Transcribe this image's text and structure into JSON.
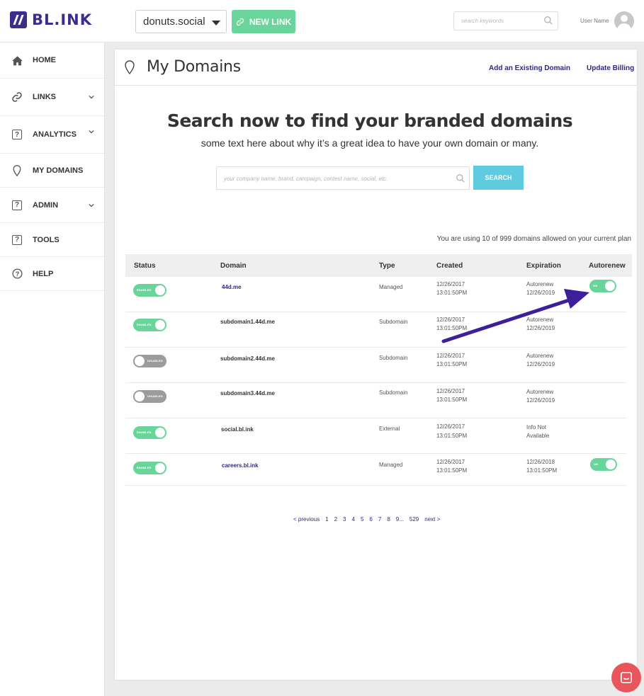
{
  "app": {
    "logo_text": "BL.INK",
    "brand_color": "#3a2d8c",
    "accent_green": "#6ad59a",
    "accent_blue": "#5ecbe0"
  },
  "topbar": {
    "domain_select_value": "donuts.social",
    "new_link_label": "NEW LINK",
    "search_placeholder": "search keywords",
    "user_name": "User Name"
  },
  "sidebar": {
    "items": [
      {
        "label": "HOME",
        "icon": "home-icon"
      },
      {
        "label": "LINKS",
        "icon": "link-icon",
        "has_chevron": true
      },
      {
        "label": "ANALYTICS",
        "icon": "question-box-icon",
        "has_chevron": true
      },
      {
        "label": "MY DOMAINS",
        "icon": "map-pin-icon"
      },
      {
        "label": "ADMIN",
        "icon": "question-box-icon",
        "has_chevron": true
      },
      {
        "label": "TOOLS",
        "icon": "question-box-icon"
      },
      {
        "label": "HELP",
        "icon": "help-circle-icon"
      }
    ]
  },
  "page": {
    "title": "My Domains",
    "add_existing_label": "Add an Existing Domain",
    "update_billing_label": "Update Billing",
    "hero_title": "Search now to find your branded domains",
    "hero_subtitle": "some text here about why it’s a great idea to have your own domain or many.",
    "search_placeholder": "your company name, brand, campaign, contest name, social, etc.",
    "search_button": "SEARCH",
    "usage_text": "You are using  10 of 999 domains allowed on your current plan"
  },
  "table": {
    "columns": [
      "Status",
      "Domain",
      "Type",
      "Created",
      "Expiration",
      "Autorenew"
    ],
    "rows": [
      {
        "status": "ENABLED",
        "domain": "44d.me",
        "type": "Managed",
        "created_date": "12/26/2017",
        "created_time": "13:01:50PM",
        "exp_line1": "Autorenew",
        "exp_line2": "12/26/2019",
        "autorenew": "ON"
      },
      {
        "status": "ENABLED",
        "domain": "subdomain1.44d.me",
        "type": "Subdomain",
        "created_date": "12/26/2017",
        "created_time": "13:01:50PM",
        "exp_line1": "Autorenew",
        "exp_line2": "12/26/2019",
        "autorenew": ""
      },
      {
        "status": "DISABLED",
        "domain": "subdomain2.44d.me",
        "type": "Subdomain",
        "created_date": "12/26/2017",
        "created_time": "13:01:50PM",
        "exp_line1": "Autorenew",
        "exp_line2": "12/26/2019",
        "autorenew": ""
      },
      {
        "status": "DISABLED",
        "domain": "subdomain3.44d.me",
        "type": "Subdomain",
        "created_date": "12/26/2017",
        "created_time": "13:01:50PM",
        "exp_line1": "Autorenew",
        "exp_line2": "12/26/2019",
        "autorenew": ""
      },
      {
        "status": "ENABLED",
        "domain": "social.bl.ink",
        "type": "External",
        "created_date": "12/26/2017",
        "created_time": "13:01:50PM",
        "exp_line1": "Info Not",
        "exp_line2": "Available",
        "autorenew": ""
      },
      {
        "status": "ENABLED",
        "domain": "careers.bl.ink",
        "type": "Managed",
        "created_date": "12/26/2017",
        "created_time": "13:01:50PM",
        "exp_line1": "12/26/2018",
        "exp_line2": "13:01:50PM",
        "autorenew": "ON"
      }
    ]
  },
  "pagination": {
    "prev": "< previous",
    "pages": [
      "1",
      "2",
      "3",
      "4",
      "5",
      "6",
      "7",
      "8",
      "9...",
      "529"
    ],
    "next": "next >"
  }
}
